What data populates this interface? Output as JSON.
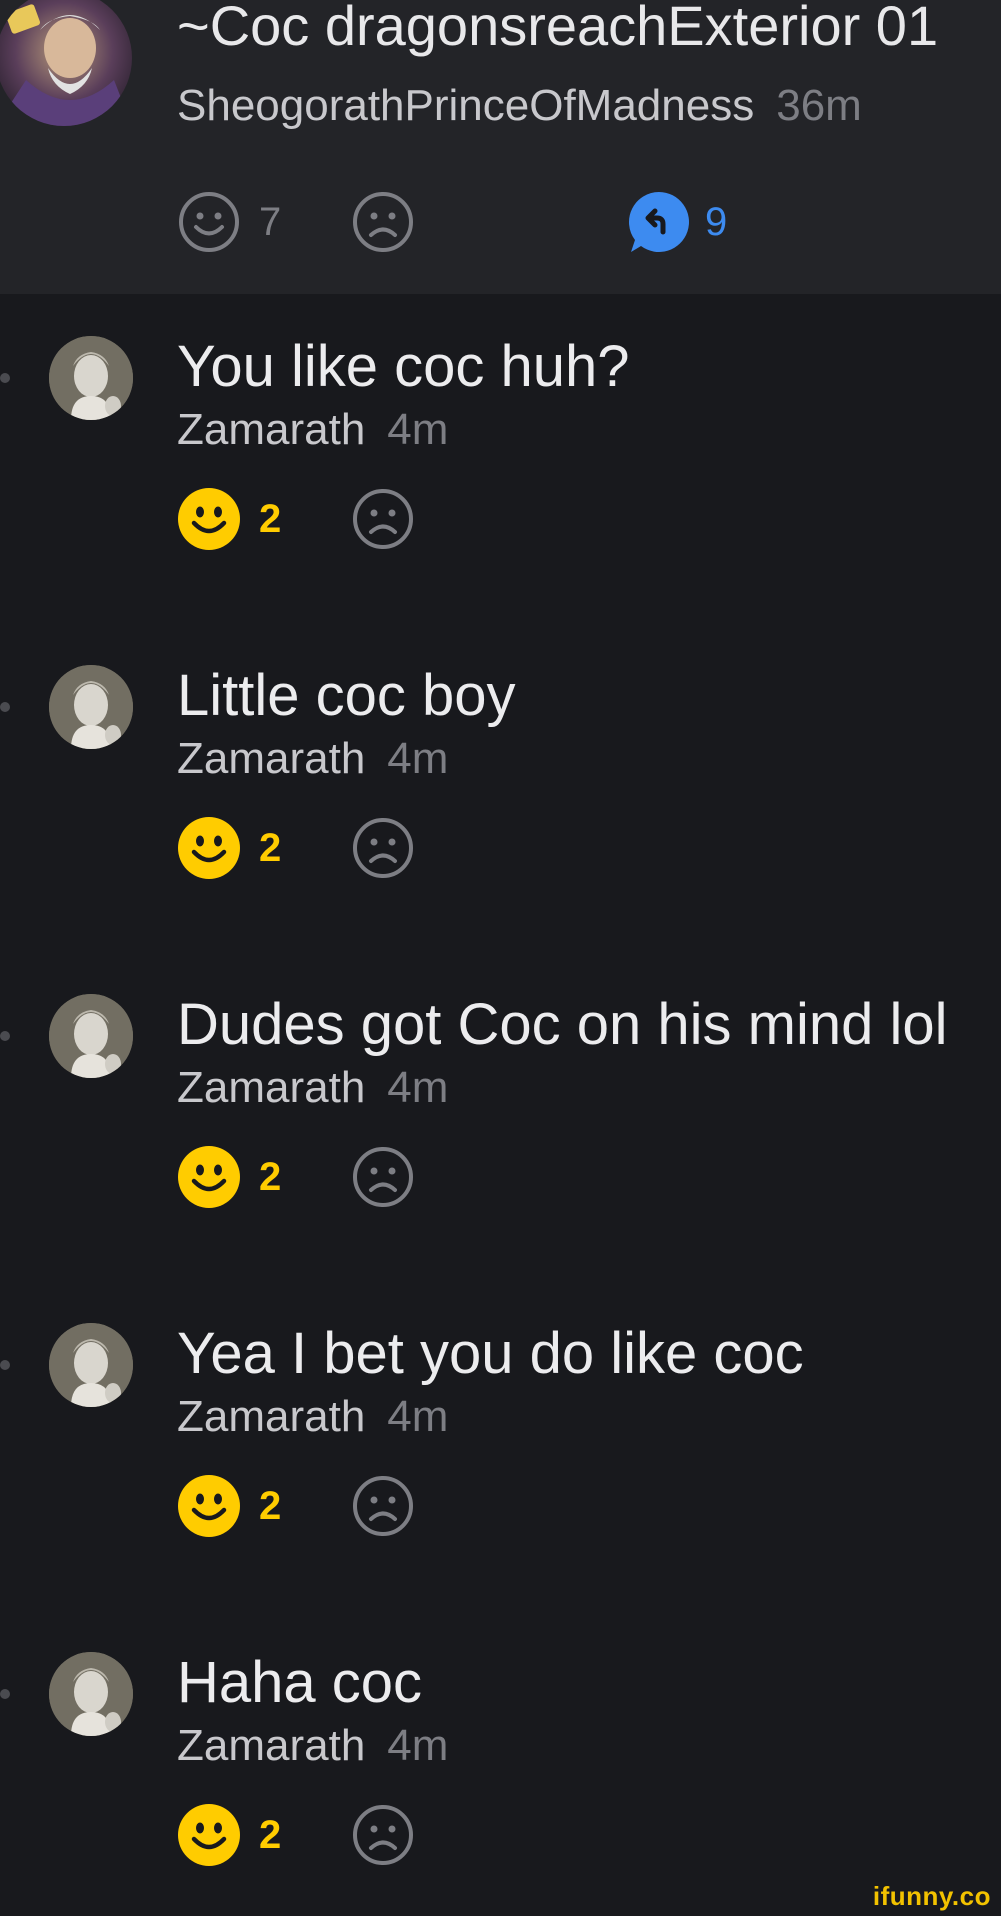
{
  "parent": {
    "title": "~Coc dragonsreachExterior 01",
    "author": "SheogorathPrinceOfMadness",
    "time": "36m",
    "smile_count": "7",
    "reply_count": "9"
  },
  "comments": [
    {
      "body": "You like coc huh?",
      "author": "Zamarath",
      "time": "4m",
      "smile_count": "2"
    },
    {
      "body": "Little coc boy",
      "author": "Zamarath",
      "time": "4m",
      "smile_count": "2"
    },
    {
      "body": "Dudes got Coc on his mind lol",
      "author": "Zamarath",
      "time": "4m",
      "smile_count": "2"
    },
    {
      "body": "Yea I bet you do like coc",
      "author": "Zamarath",
      "time": "4m",
      "smile_count": "2"
    },
    {
      "body": "Haha coc",
      "author": "Zamarath",
      "time": "4m",
      "smile_count": "2"
    }
  ],
  "watermark": "ifunny.co",
  "colors": {
    "background": "#18191d",
    "parent_background": "#232428",
    "smile_active": "#ffcc00",
    "reply_accent": "#3d8bf0",
    "muted": "#7d7e84"
  },
  "icons": {
    "smile": "smile-icon",
    "unsmile": "frown-icon",
    "reply": "reply-icon"
  }
}
